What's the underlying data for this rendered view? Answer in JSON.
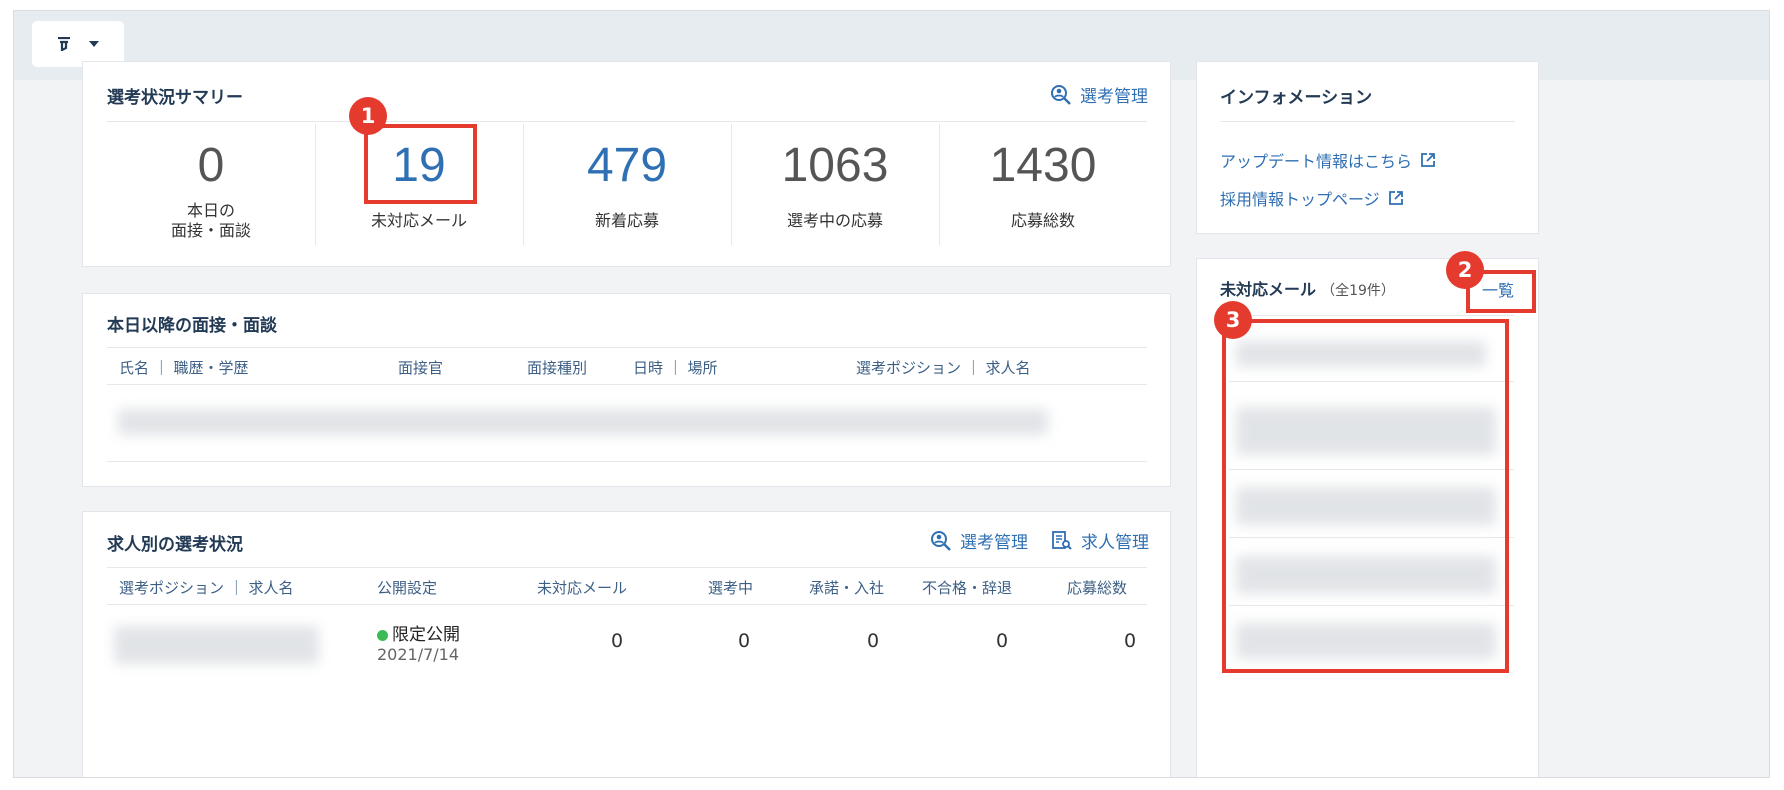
{
  "summary": {
    "title": "選考状況サマリー",
    "manage_link": "選考管理",
    "stats": [
      {
        "value": "0",
        "label_line1": "本日の",
        "label_line2": "面接・面談"
      },
      {
        "value": "19",
        "label_line1": "未対応メール",
        "label_line2": ""
      },
      {
        "value": "479",
        "label_line1": "新着応募",
        "label_line2": ""
      },
      {
        "value": "1063",
        "label_line1": "選考中の応募",
        "label_line2": ""
      },
      {
        "value": "1430",
        "label_line1": "応募総数",
        "label_line2": ""
      }
    ]
  },
  "interviews": {
    "title": "本日以降の面接・面談",
    "columns": [
      "氏名 ｜ 職歴・学歴",
      "面接官",
      "面接種別",
      "日時 ｜ 場所",
      "選考ポジション ｜ 求人名"
    ]
  },
  "jobs": {
    "title": "求人別の選考状況",
    "manage_link": "選考管理",
    "job_manage_link": "求人管理",
    "columns": [
      "選考ポジション ｜ 求人名",
      "公開設定",
      "未対応メール",
      "選考中",
      "承諾・入社",
      "不合格・辞退",
      "応募総数"
    ],
    "row": {
      "status": "限定公開",
      "date": "2021/7/14",
      "unread": "0",
      "in_progress": "0",
      "accepted": "0",
      "rejected": "0",
      "total": "0"
    }
  },
  "info": {
    "title": "インフォメーション",
    "links": [
      "アップデート情報はこちら",
      "採用情報トップページ"
    ]
  },
  "mail": {
    "title": "未対応メール",
    "count": "（全19件）",
    "list_link": "一覧"
  },
  "annotations": [
    "1",
    "2",
    "3"
  ],
  "colors": {
    "accent": "#2f6fb3",
    "annotation": "#e53b2f",
    "status_green": "#3cba54"
  }
}
